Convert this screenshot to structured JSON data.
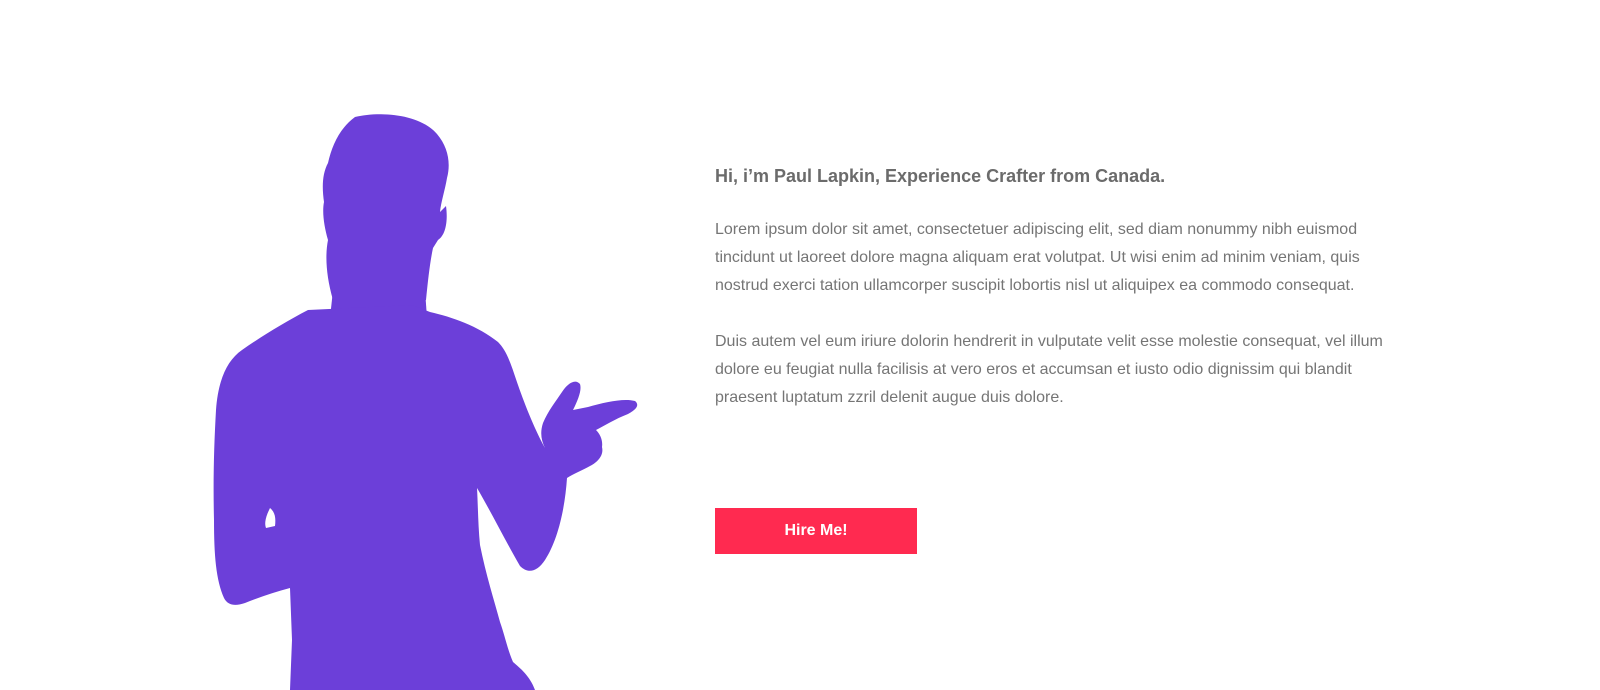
{
  "about": {
    "headline": "Hi, i’m Paul Lapkin, Experience Crafter from Canada.",
    "paragraphs": [
      "Lorem ipsum dolor sit amet, consectetuer adipiscing elit, sed diam nonummy nibh euismod tincidunt ut laoreet dolore magna aliquam erat volutpat. Ut wisi enim ad minim veniam, quis nostrud exerci tation ullamcorper suscipit lobortis nisl ut aliquipex ea commodo consequat.",
      " Duis autem vel eum iriure dolorin hendrerit in vulputate velit esse molestie consequat, vel illum dolore eu feugiat nulla facilisis at vero eros et accumsan et iusto odio dignissim qui blandit praesent luptatum zzril delenit augue duis dolore."
    ],
    "button_label": "Hire Me!"
  },
  "icons": {
    "portrait": "person-pointing-silhouette-icon"
  },
  "colors": {
    "silhouette": "#6c3fd9",
    "button": "#ff2a50",
    "button_text": "#ffffff"
  }
}
